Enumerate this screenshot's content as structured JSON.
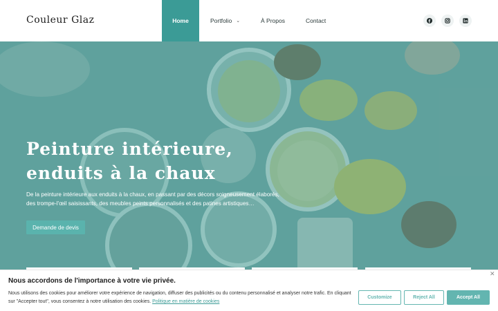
{
  "header": {
    "logo": "Couleur Glaz",
    "nav": {
      "home": "Home",
      "portfolio": "Portfolio",
      "apropos": "À Propos",
      "contact": "Contact"
    },
    "social": [
      "facebook-icon",
      "instagram-icon",
      "linkedin-icon"
    ]
  },
  "hero": {
    "title": "Peinture intérieure, enduits à la chaux",
    "description": "De la peinture intérieure aux enduits à la chaux, en passant par des décors soigneusement élaborés, des trompe-l'œil saisissants, des meubles peints personnalisés et des patines artistiques…",
    "cta": "Demande de devis"
  },
  "cookie": {
    "title": "Nous accordons de l'importance à votre vie privée.",
    "text": "Nous utilisons des cookies pour améliorer votre expérience de navigation, diffuser des publicités ou du contenu personnalisé et analyser notre trafic. En cliquant sur \"Accepter tout\", vous consentez à notre utilisation des cookies.",
    "link": "Politique en matière de cookies",
    "customize": "Customize",
    "reject": "Reject All",
    "accept": "Accept All"
  },
  "colors": {
    "accent": "#3b9b96",
    "button": "#63b5b0",
    "overlay": "#3c9691"
  }
}
